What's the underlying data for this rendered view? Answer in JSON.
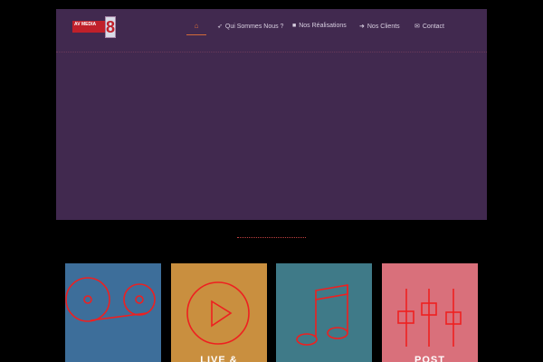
{
  "logo": {
    "text": "AV MEDIA",
    "tagline": "8"
  },
  "nav": {
    "home_icon": "home-icon",
    "items": [
      {
        "label": "Qui Sommes Nous ?",
        "icon": "rocket-icon"
      },
      {
        "label": "Nos Réalisations",
        "icon": "briefcase-icon"
      },
      {
        "label": "Nos Clients",
        "icon": "arrow-right-icon"
      },
      {
        "label": "Contact",
        "icon": "envelope-icon"
      }
    ]
  },
  "tiles": [
    {
      "title": "",
      "color": "#3d6e9a",
      "icon": "tape-reel-icon"
    },
    {
      "title": "LIVE &",
      "color": "#c98f3f",
      "icon": "play-circle-icon"
    },
    {
      "title": "",
      "color": "#3f7a88",
      "icon": "music-note-icon"
    },
    {
      "title": "POST",
      "color": "#d9707b",
      "icon": "mixer-sliders-icon"
    }
  ],
  "colors": {
    "hero": "#41294f",
    "accent": "#ee2020"
  }
}
